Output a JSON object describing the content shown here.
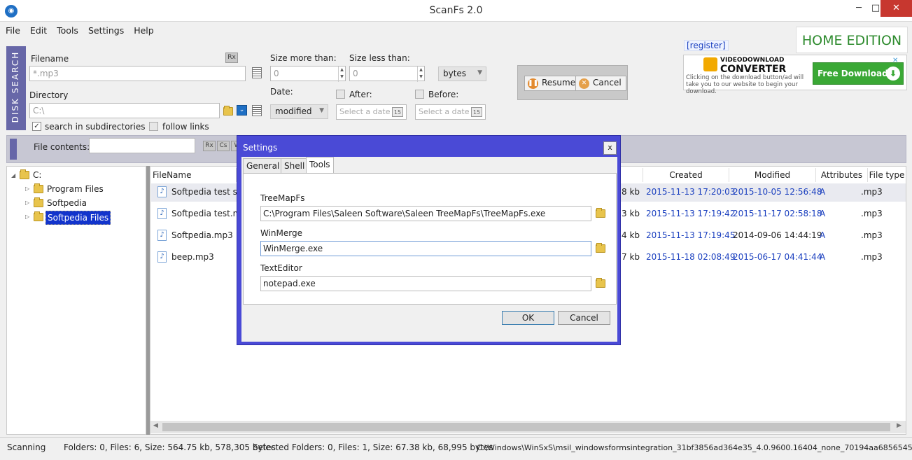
{
  "window": {
    "title": "ScanFs 2.0",
    "icon": "scanfs-app-icon",
    "controls": {
      "minimize": "─",
      "maximize": "□",
      "close": "✕"
    }
  },
  "menu": [
    "File",
    "Edit",
    "Tools",
    "Settings",
    "Help"
  ],
  "disk_search": {
    "side_label": "DISK SEARCH",
    "filename_label": "Filename",
    "filename_value": "*.mp3",
    "regex_btn": "Rx",
    "directory_label": "Directory",
    "directory_value": "C:\\",
    "search_subdirs_label": "search in subdirectories",
    "search_subdirs_checked": true,
    "follow_links_label": "follow links",
    "follow_links_checked": false,
    "size_more_label": "Size more than:",
    "size_more_value": "0",
    "size_less_label": "Size less than:",
    "size_less_value": "0",
    "size_unit": "bytes",
    "date_label": "Date:",
    "date_mode": "modified",
    "after_label": "After:",
    "after_placeholder": "Select a date",
    "before_label": "Before:",
    "before_placeholder": "Select a date",
    "calendar_glyph": "15",
    "resume_label": "Resume",
    "cancel_label": "Cancel"
  },
  "promo": {
    "register_label": "[register]",
    "home_edition": "HOME EDITION",
    "ad_brand_top": "VIDEODOWNLOAD",
    "ad_brand": "CONVERTER",
    "ad_text": "Clicking on the download button/ad will take you to our website to begin your download.",
    "ad_button": "Free Download",
    "ad_close": "✕"
  },
  "file_contents": {
    "label": "File contents:",
    "value": "",
    "btn_rx": "Rx",
    "btn_cs": "Cs",
    "btn_w": "W"
  },
  "tree": [
    {
      "label": "C:",
      "expanded": true,
      "level": 0
    },
    {
      "label": "Program Files",
      "level": 1
    },
    {
      "label": "Softpedia",
      "level": 1
    },
    {
      "label": "Softpedia Files",
      "level": 1,
      "selected": true
    }
  ],
  "file_list": {
    "columns": [
      "FileName",
      "Created",
      "Modified",
      "Attributes",
      "File type"
    ],
    "rows": [
      {
        "name": "Softpedia test slid",
        "size": "8 kb",
        "created": "2015-11-13 17:20:03",
        "modified": "2015-10-05 12:56:48",
        "attr": "A",
        "type": ".mp3"
      },
      {
        "name": "Softpedia test.mp",
        "size": "3 kb",
        "created": "2015-11-13 17:19:42",
        "modified": "2015-11-17 02:58:18",
        "attr": "A",
        "type": ".mp3"
      },
      {
        "name": "Softpedia.mp3",
        "size": "4 kb",
        "created": "2015-11-13 17:19:45",
        "modified": "2014-09-06 14:44:19",
        "attr": "A",
        "type": ".mp3"
      },
      {
        "name": "beep.mp3",
        "size": "7 kb",
        "created": "2015-11-18 02:08:49",
        "modified": "2015-06-17 04:41:44",
        "attr": "A",
        "type": ".mp3"
      }
    ]
  },
  "status": {
    "state": "Scanning",
    "totals": "Folders: 0, Files: 6, Size: 564.75 kb, 578,305 bytes",
    "selected": "Selected Folders: 0, Files: 1, Size: 67.38 kb, 68,995 bytes",
    "path": "C:\\Windows\\WinSxS\\msil_windowsformsintegration_31bf3856ad364e35_4.0.9600.16404_none_70194aa68565455f"
  },
  "settings_dialog": {
    "title": "Settings",
    "close": "x",
    "tabs": [
      "General",
      "Shell",
      "Tools"
    ],
    "active_tab": "Tools",
    "fields": [
      {
        "label": "TreeMapFs",
        "value": "C:\\Program Files\\Saleen Software\\Saleen TreeMapFs\\TreeMapFs.exe"
      },
      {
        "label": "WinMerge",
        "value": "WinMerge.exe"
      },
      {
        "label": "TextEditor",
        "value": "notepad.exe"
      }
    ],
    "ok_label": "OK",
    "cancel_label": "Cancel"
  },
  "colors": {
    "accent_side": "#6767a8",
    "dialog_frame": "#4a4ad6",
    "selection": "#1234cc",
    "date_blue": "#1a3fbf",
    "home_edition_green": "#2e8b2e"
  }
}
